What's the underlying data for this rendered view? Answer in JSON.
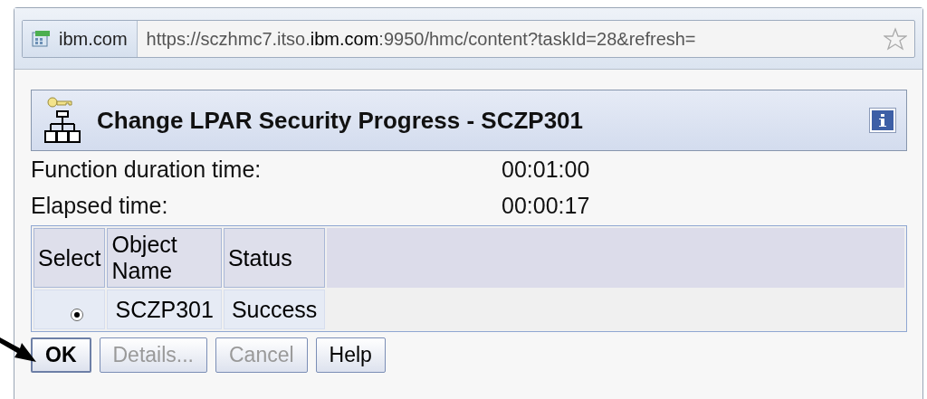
{
  "browser": {
    "site_badge": "ibm.com",
    "url": "https://sczhmc7.itso.**ibm.com**:9950/hmc/content?taskId=28&refresh="
  },
  "dialog": {
    "title": "Change LPAR Security Progress - SCZP301",
    "fields": [
      {
        "label": "Function duration time:",
        "value": "00:01:00"
      },
      {
        "label": "Elapsed time:",
        "value": "00:00:17"
      }
    ],
    "table": {
      "columns": [
        "Select",
        "Object Name",
        "Status"
      ],
      "rows": [
        {
          "selected": true,
          "object_name": "SCZP301",
          "status": "Success"
        }
      ]
    },
    "buttons": [
      {
        "label": "OK",
        "default": true,
        "disabled": false
      },
      {
        "label": "Details...",
        "default": false,
        "disabled": true
      },
      {
        "label": "Cancel",
        "default": false,
        "disabled": true
      },
      {
        "label": "Help",
        "default": false,
        "disabled": false
      }
    ]
  }
}
